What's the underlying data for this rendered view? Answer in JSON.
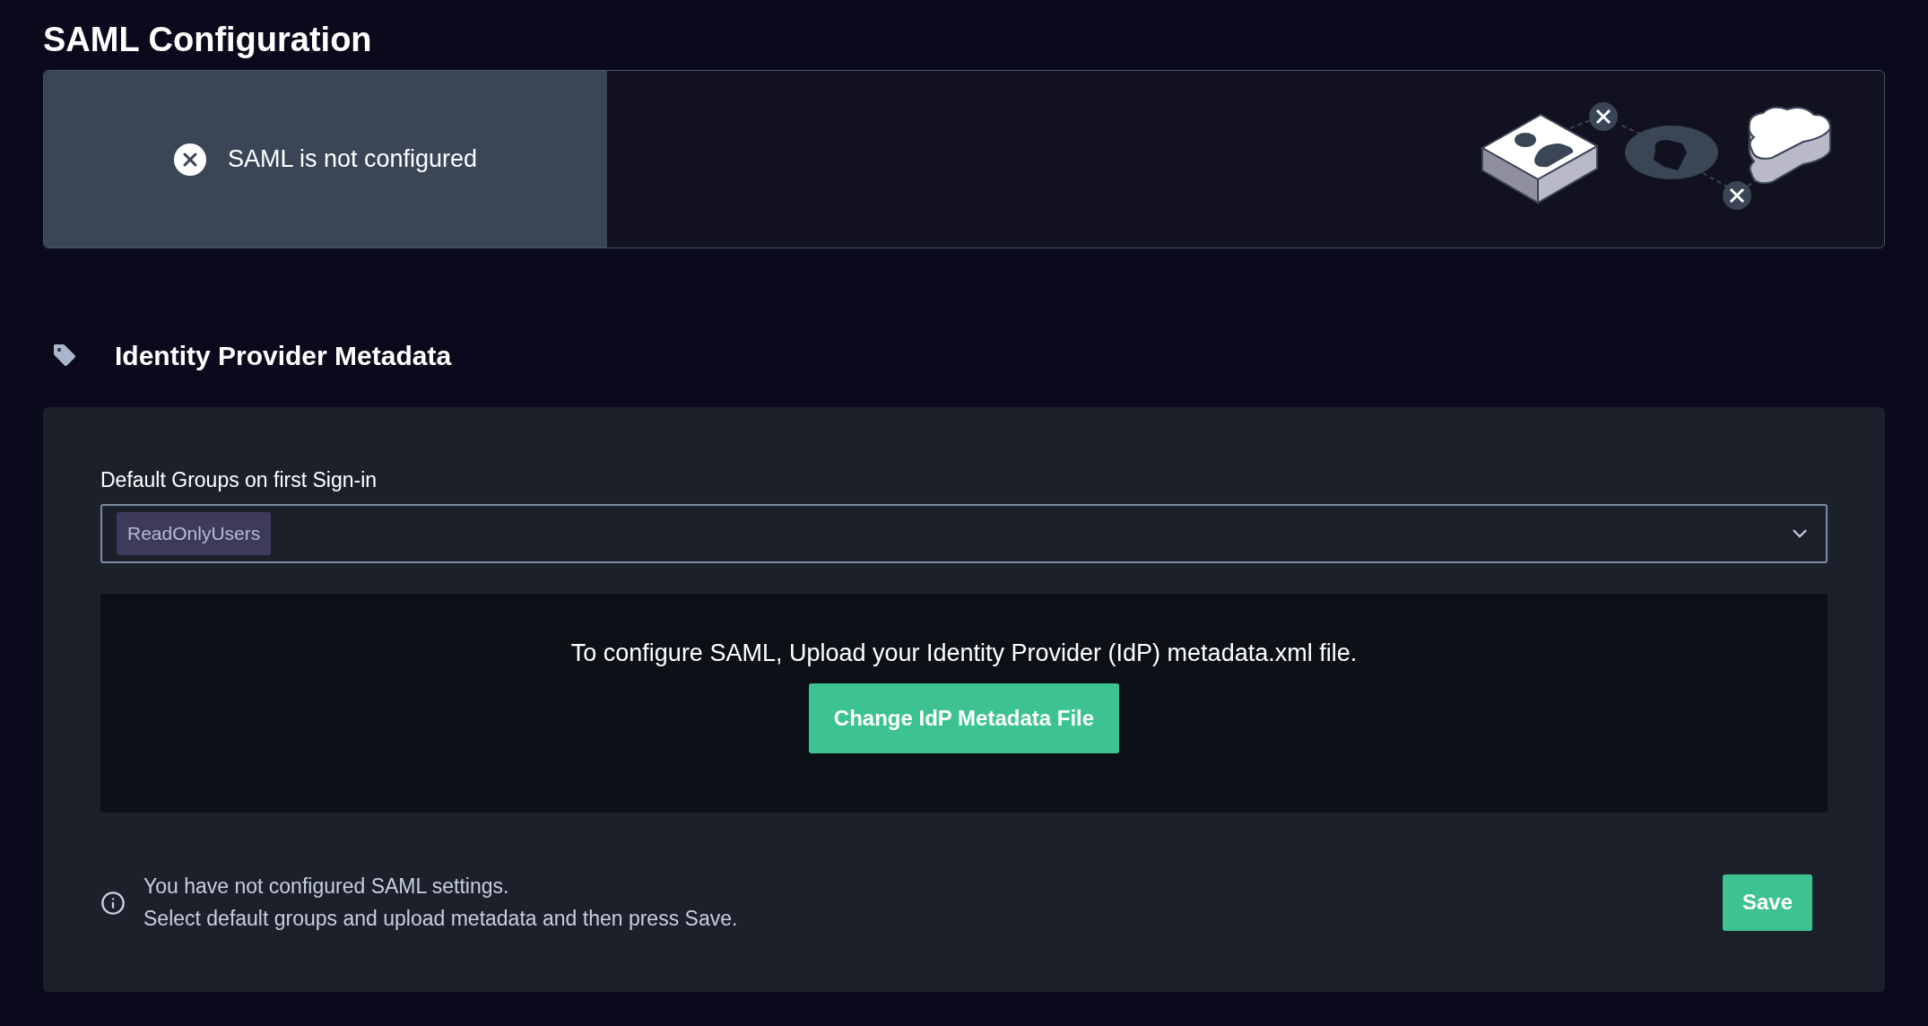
{
  "title": "SAML Configuration",
  "status": {
    "text": "SAML is not configured",
    "configured": false
  },
  "section": {
    "title": "Identity Provider Metadata"
  },
  "groups_field": {
    "label": "Default Groups on first Sign-in",
    "tags": [
      "ReadOnlyUsers"
    ]
  },
  "upload": {
    "text": "To configure SAML, Upload your Identity Provider (IdP) metadata.xml file.",
    "button": "Change IdP Metadata File"
  },
  "notice": {
    "lines": [
      "You have not configured SAML settings.",
      "Select default groups and upload metadata and then press Save."
    ]
  },
  "save_button": "Save"
}
